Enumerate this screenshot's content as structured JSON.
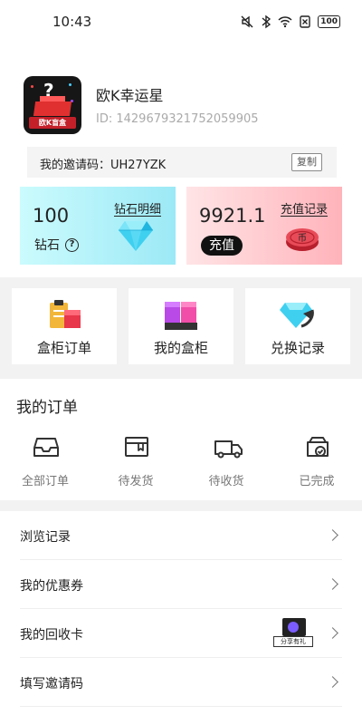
{
  "status_bar": {
    "time": "10:43",
    "battery": "100"
  },
  "profile": {
    "name": "欧K幸运星",
    "id_text": "ID: 1429679321752059905",
    "avatar_text": "欧K盲盒"
  },
  "invite": {
    "text": "我的邀请码：UH27YZK",
    "copy_label": "复制"
  },
  "diamond_card": {
    "value": "100",
    "label": "钻石",
    "link": "钻石明细",
    "help_glyph": "?"
  },
  "coin_card": {
    "value": "9921.1",
    "link": "充值记录",
    "recharge_label": "充值",
    "coin_glyph": "币"
  },
  "shortcuts": [
    {
      "label": "盒柜订单"
    },
    {
      "label": "我的盒柜"
    },
    {
      "label": "兑换记录"
    }
  ],
  "orders": {
    "title": "我的订单",
    "items": [
      {
        "label": "全部订单"
      },
      {
        "label": "待发货"
      },
      {
        "label": "待收货"
      },
      {
        "label": "已完成"
      }
    ]
  },
  "menu": [
    {
      "label": "浏览记录"
    },
    {
      "label": "我的优惠券"
    },
    {
      "label": "我的回收卡",
      "badge": "分享有礼"
    },
    {
      "label": "填写邀请码"
    }
  ],
  "colors": {
    "diamond_card_start": "#cbfbfd",
    "diamond_card_end": "#9ce9f6",
    "coin_card_start": "#ffe4e6",
    "coin_card_end": "#ffb3ba",
    "section_gray": "#f2f2f2",
    "recharge_button": "#111111"
  }
}
